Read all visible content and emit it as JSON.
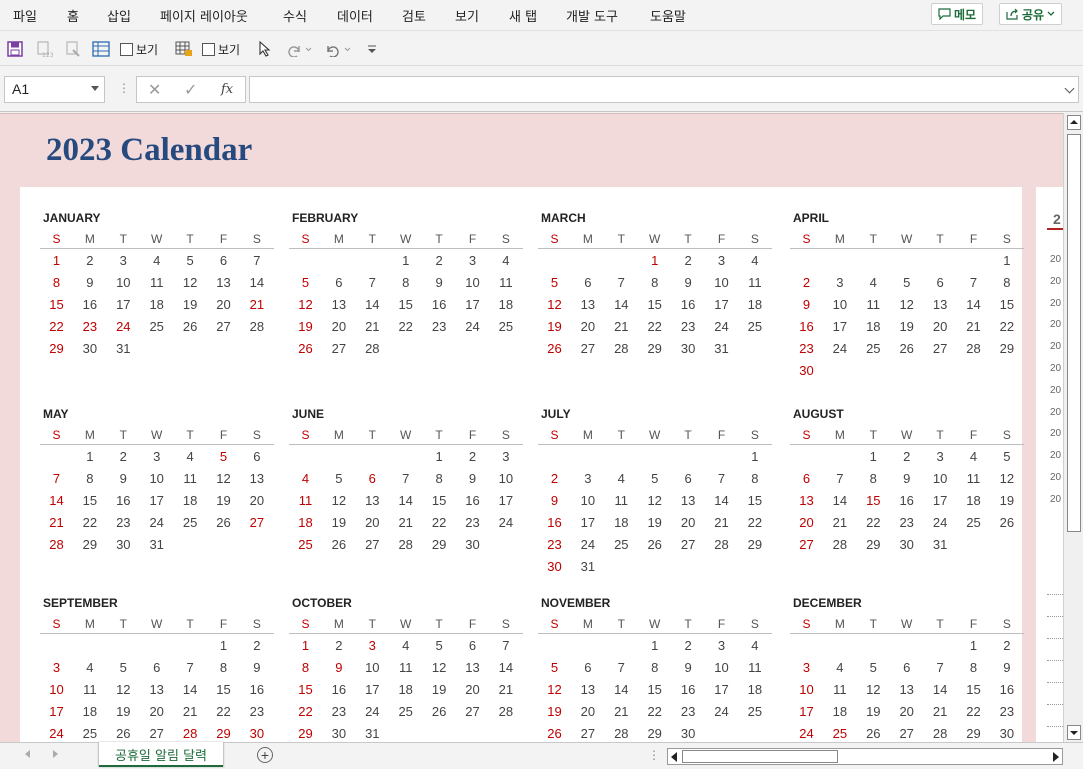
{
  "ribbon": {
    "tabs": [
      "파일",
      "홈",
      "삽입",
      "페이지 레이아웃",
      "수식",
      "데이터",
      "검토",
      "보기",
      "새 탭",
      "개발 도구",
      "도움말"
    ],
    "memo_label": "메모",
    "share_label": "공유"
  },
  "toolbar": {
    "view_label_1": "보기",
    "view_label_2": "보기"
  },
  "formula_bar": {
    "name_box": "A1",
    "formula": ""
  },
  "sheet": {
    "title": "2023 Calendar",
    "tab_name": "공휴일 알림 달력",
    "side_label": "2",
    "side_rows": [
      "20",
      "20",
      "20",
      "20",
      "20",
      "20",
      "20",
      "20",
      "20",
      "20",
      "20",
      "20"
    ],
    "weekdays": [
      "S",
      "M",
      "T",
      "W",
      "T",
      "F",
      "S"
    ]
  },
  "colors": {
    "title": "#264a7e",
    "holiday": "#c00000",
    "sheet_bg": "#f2d9da",
    "accent": "#1d6b3a"
  },
  "months": [
    {
      "name": "JANUARY",
      "start": 0,
      "days": 31,
      "holidays": [
        21,
        22,
        23,
        24
      ]
    },
    {
      "name": "FEBRUARY",
      "start": 3,
      "days": 28,
      "holidays": []
    },
    {
      "name": "MARCH",
      "start": 3,
      "days": 31,
      "holidays": [
        1
      ]
    },
    {
      "name": "APRIL",
      "start": 6,
      "days": 30,
      "holidays": []
    },
    {
      "name": "MAY",
      "start": 1,
      "days": 31,
      "holidays": [
        5,
        27
      ]
    },
    {
      "name": "JUNE",
      "start": 4,
      "days": 30,
      "holidays": [
        6
      ]
    },
    {
      "name": "JULY",
      "start": 6,
      "days": 31,
      "holidays": []
    },
    {
      "name": "AUGUST",
      "start": 2,
      "days": 31,
      "holidays": [
        15
      ]
    },
    {
      "name": "SEPTEMBER",
      "start": 5,
      "days": 30,
      "holidays": [
        28,
        29,
        30
      ]
    },
    {
      "name": "OCTOBER",
      "start": 0,
      "days": 31,
      "holidays": [
        3,
        9
      ]
    },
    {
      "name": "NOVEMBER",
      "start": 3,
      "days": 30,
      "holidays": []
    },
    {
      "name": "DECEMBER",
      "start": 5,
      "days": 31,
      "holidays": [
        25
      ]
    }
  ]
}
